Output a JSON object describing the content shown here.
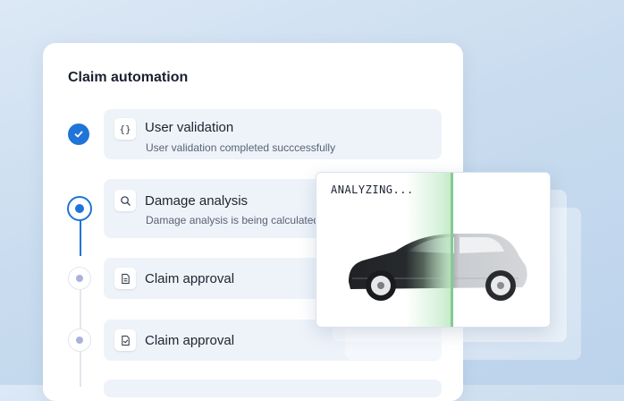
{
  "panel": {
    "title": "Claim automation"
  },
  "steps": [
    {
      "label": "User validation",
      "subtitle": "User validation completed succcessfully",
      "icon": "braces-icon",
      "icon_glyph": "{}",
      "state": "done"
    },
    {
      "label": "Damage analysis",
      "subtitle": "Damage analysis is being calculated",
      "icon": "search-icon",
      "state": "current"
    },
    {
      "label": "Claim approval",
      "subtitle": "",
      "icon": "document-icon",
      "state": "pending"
    },
    {
      "label": "Claim approval",
      "subtitle": "",
      "icon": "document-check-icon",
      "state": "pending"
    }
  ],
  "analyzer": {
    "status": "ANALYZING..."
  },
  "colors": {
    "accent": "#1f74d8",
    "pending_dot": "#a9b2dc",
    "scan": "#86c991",
    "card_bg": "#eef3fa"
  }
}
